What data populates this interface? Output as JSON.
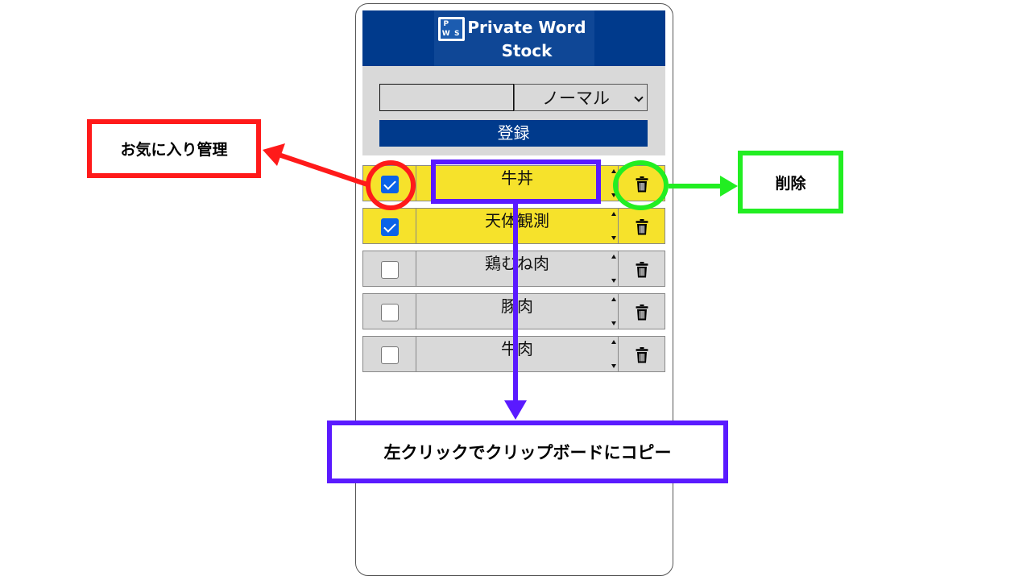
{
  "app": {
    "title": "Private Word Stock",
    "logo_letters": [
      "P",
      "",
      "W",
      "S"
    ],
    "colors": {
      "header": "#003a8c",
      "favorite_row": "#f6e22b",
      "normal_row": "#d9d9d9",
      "checkbox_checked": "#0b63e8"
    }
  },
  "form": {
    "word_input_value": "",
    "mode_select_value": "ノーマル",
    "register_label": "登録"
  },
  "words": [
    {
      "text": "牛丼",
      "favorite": true
    },
    {
      "text": "天体観測",
      "favorite": true
    },
    {
      "text": "鶏むね肉",
      "favorite": false
    },
    {
      "text": "豚肉",
      "favorite": false
    },
    {
      "text": "牛肉",
      "favorite": false
    }
  ],
  "icons": {
    "delete": "trash-icon",
    "select": "chevron-down-icon"
  },
  "annotations": {
    "favorite": {
      "label": "お気に入り管理",
      "color": "#ff1a1a"
    },
    "delete": {
      "label": "削除",
      "color": "#22ee22"
    },
    "copy": {
      "label": "左クリックでクリップボードにコピー",
      "color": "#5a1aff"
    }
  }
}
